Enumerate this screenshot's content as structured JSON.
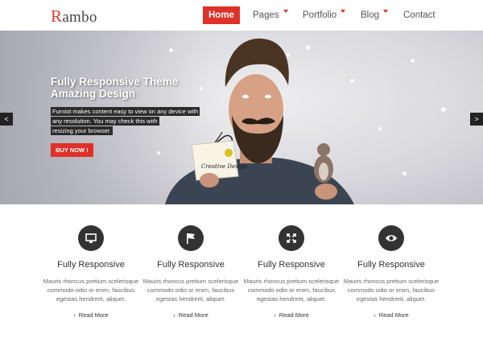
{
  "header": {
    "logo": "Rambo",
    "nav": [
      {
        "label": "Home",
        "active": true,
        "dropdown": false
      },
      {
        "label": "Pages",
        "active": false,
        "dropdown": true
      },
      {
        "label": "Portfolio",
        "active": false,
        "dropdown": true
      },
      {
        "label": "Blog",
        "active": false,
        "dropdown": true
      },
      {
        "label": "Contact",
        "active": false,
        "dropdown": false
      }
    ]
  },
  "hero": {
    "title_line1": "Fully Responsive Theme",
    "title_line2": "Amazing Design",
    "desc_lines": [
      "Furniot makes content easy to view on any device with",
      "any resolution. You may check this with",
      "resizing your browser."
    ],
    "button_label": "BUY NOW !",
    "prev_label": "<",
    "next_label": ">",
    "card_text": "Creative Design"
  },
  "features": [
    {
      "icon": "monitor-icon",
      "title": "Fully Responsive",
      "text": "Mauris rhoncus pretium scelerisque commodo odio or enim, faucibus egestas hendrerit, aliquet.",
      "link": "Read More"
    },
    {
      "icon": "flag-icon",
      "title": "Fully Responsive",
      "text": "Mauris rhoncus pretium scelerisque commodo odio or enim, faucibus egestas hendrerit, aliquet.",
      "link": "Read More"
    },
    {
      "icon": "fullscreen-icon",
      "title": "Fully Responsive",
      "text": "Mauris rhoncus pretium scelerisque commodo odio or enim, faucibus egestas hendrerit, aliquet.",
      "link": "Read More"
    },
    {
      "icon": "eye-icon",
      "title": "Fully Responsive",
      "text": "Mauris rhoncus pretium scelerisque commodo odio or enim, faucibus egestas hendrerit, aliquet.",
      "link": "Read More"
    }
  ],
  "colors": {
    "accent": "#e0302a",
    "dark": "#333333"
  }
}
